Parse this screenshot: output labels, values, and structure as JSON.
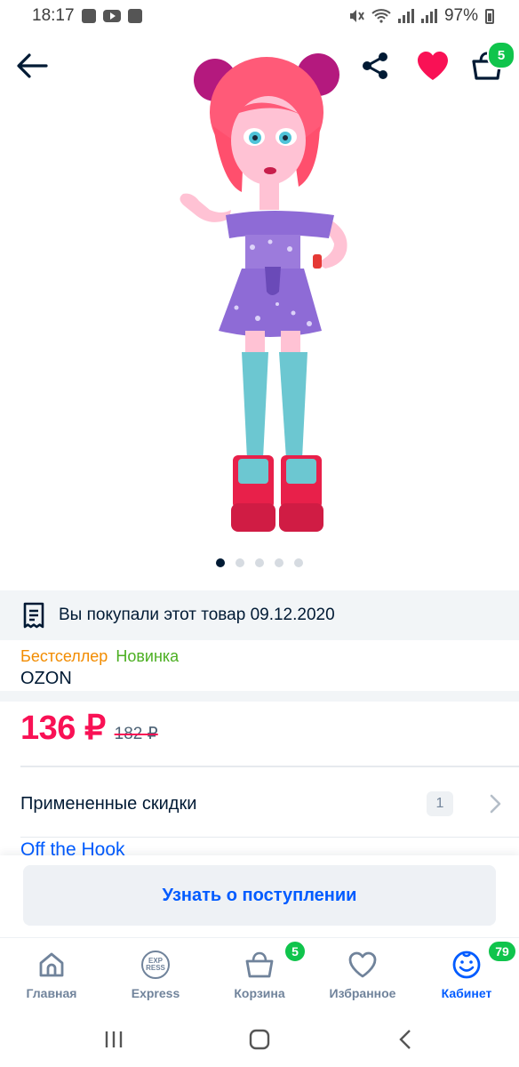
{
  "status_bar": {
    "time": "18:17",
    "battery": "97%"
  },
  "cart": {
    "count": "5"
  },
  "product": {
    "gallery": {
      "total_images": 5,
      "active_index": 0
    },
    "purchased_note": "Вы покупали этот товар 09.12.2020",
    "badges": {
      "bestseller": "Бестселлер",
      "new": "Новинка"
    },
    "seller": "OZON",
    "price": {
      "current": "136 ₽",
      "old": "182 ₽"
    },
    "discounts": {
      "label": "Примененные скидки",
      "count": "1"
    },
    "brand_link": "Off the Hook"
  },
  "actions": {
    "notify_label": "Узнать о поступлении"
  },
  "bottom_nav": {
    "items": [
      {
        "label": "Главная",
        "icon": "home-icon"
      },
      {
        "label": "Express",
        "icon": "express-icon"
      },
      {
        "label": "Корзина",
        "icon": "cart-icon",
        "badge": "5"
      },
      {
        "label": "Избранное",
        "icon": "heart-outline-icon"
      },
      {
        "label": "Кабинет",
        "icon": "profile-icon",
        "badge": "79",
        "active": true
      }
    ],
    "express_logo": {
      "top": "EXP",
      "bottom": "RESS"
    }
  },
  "colors": {
    "price": "#f91155",
    "accent_blue": "#005bff",
    "badge_green": "#10c44c",
    "bestseller": "#f28c00",
    "new": "#4caf22"
  }
}
